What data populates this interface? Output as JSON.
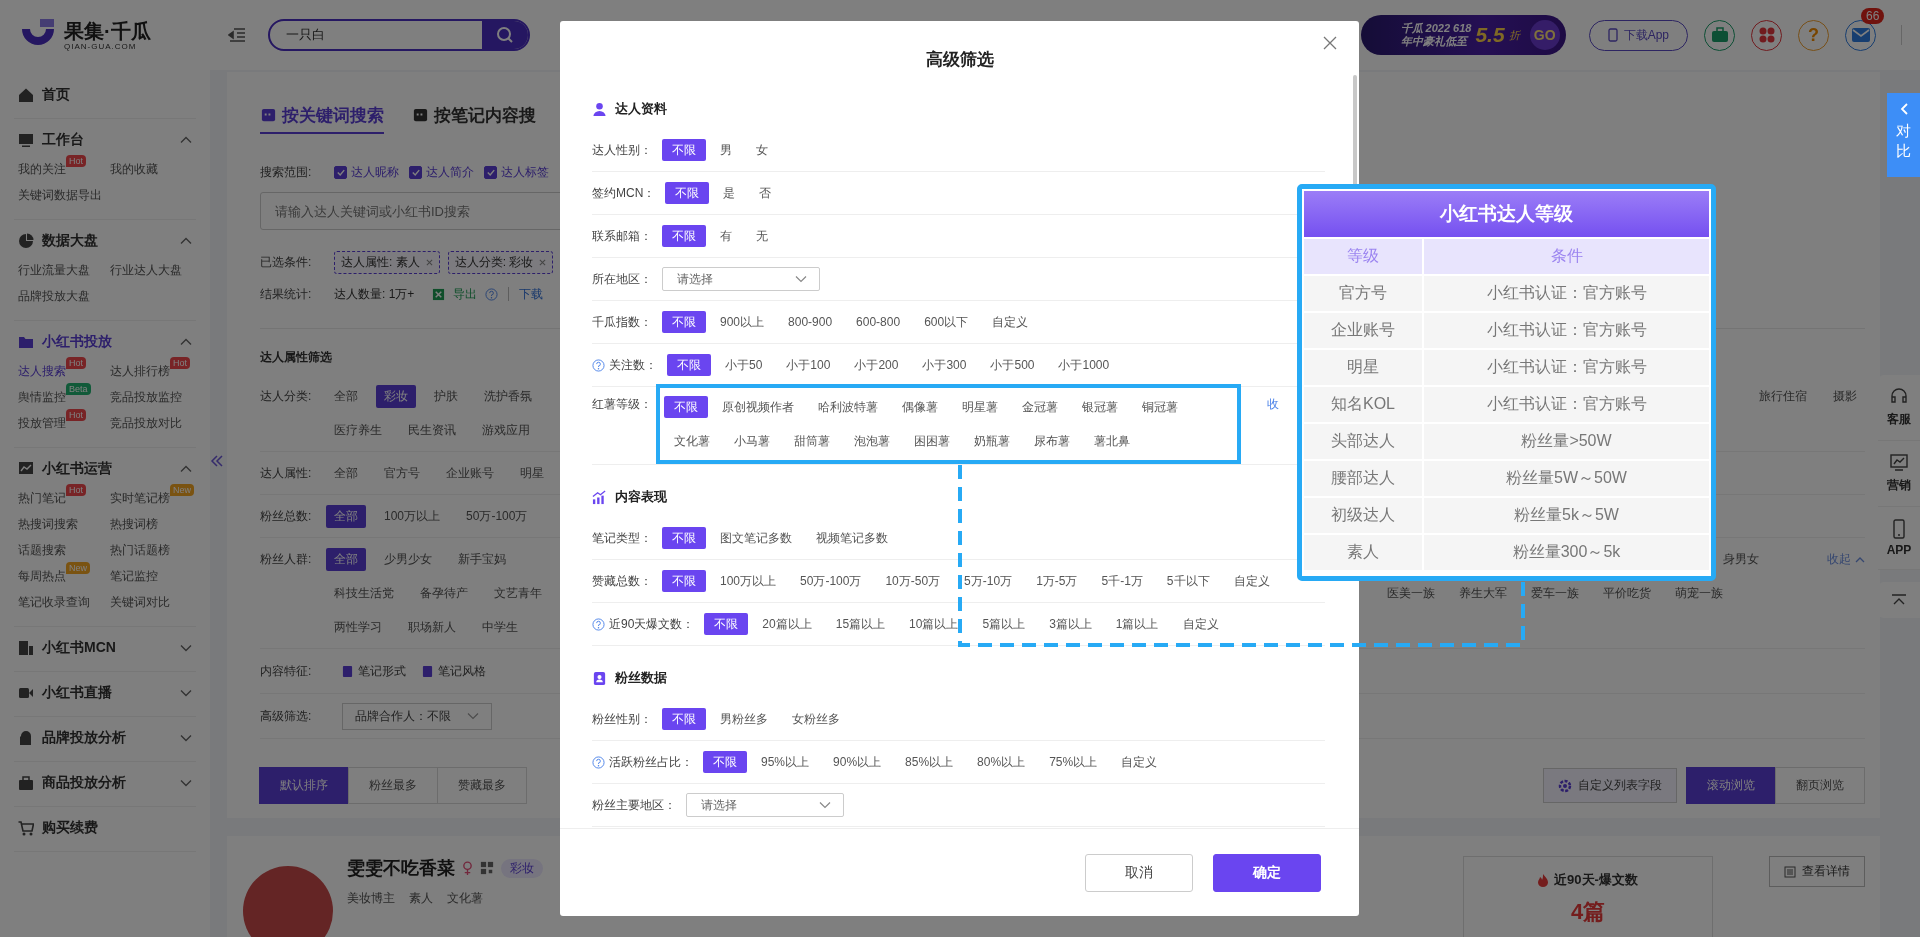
{
  "header": {
    "logo_name": "果集·千瓜",
    "logo_domain": "QIAN-GUA.COM",
    "search_value": "一只白",
    "promo": {
      "line1": "千瓜 2022 618",
      "line2": "年中豪礼低至",
      "discount": "5.5",
      "unit": "折",
      "go": "GO"
    },
    "download": "下载App",
    "help_glyph": "?",
    "mail_badge": "66"
  },
  "sidebar": [
    {
      "kind": "link",
      "label": "首页",
      "selected": false
    },
    {
      "kind": "group",
      "label": "工作台",
      "expanded": true,
      "selected": false,
      "children": [
        {
          "label": "我的关注",
          "badge": {
            "text": "Hot",
            "kind": "hot"
          },
          "selected": false
        },
        {
          "label": "我的收藏",
          "selected": false
        },
        {
          "label": "关键词数据导出",
          "selected": false
        }
      ]
    },
    {
      "kind": "group",
      "label": "数据大盘",
      "expanded": true,
      "selected": false,
      "children": [
        {
          "label": "行业流量大盘",
          "selected": false
        },
        {
          "label": "行业达人大盘",
          "selected": false
        },
        {
          "label": "品牌投放大盘",
          "selected": false
        }
      ]
    },
    {
      "kind": "group",
      "label": "小红书投放",
      "expanded": true,
      "selected": true,
      "children": [
        {
          "label": "达人搜索",
          "badge": {
            "text": "Hot",
            "kind": "hot"
          },
          "selected": true
        },
        {
          "label": "达人排行榜",
          "badge": {
            "text": "Hot",
            "kind": "hot"
          },
          "selected": false
        },
        {
          "label": "舆情监控",
          "badge": {
            "text": "Beta",
            "kind": "beta"
          },
          "selected": false
        },
        {
          "label": "竞品投放监控",
          "selected": false
        },
        {
          "label": "投放管理",
          "badge": {
            "text": "Hot",
            "kind": "hot"
          },
          "selected": false
        },
        {
          "label": "竞品投放对比",
          "selected": false
        }
      ]
    },
    {
      "kind": "group",
      "label": "小红书运营",
      "expanded": true,
      "selected": false,
      "children": [
        {
          "label": "热门笔记",
          "badge": {
            "text": "Hot",
            "kind": "hot"
          },
          "selected": false
        },
        {
          "label": "实时笔记榜",
          "badge": {
            "text": "New",
            "kind": "new"
          },
          "selected": false
        },
        {
          "label": "热搜词搜索",
          "selected": false
        },
        {
          "label": "热搜词榜",
          "selected": false
        },
        {
          "label": "话题搜索",
          "selected": false
        },
        {
          "label": "热门话题榜",
          "selected": false
        },
        {
          "label": "每周热点",
          "badge": {
            "text": "New",
            "kind": "new"
          },
          "selected": false
        },
        {
          "label": "笔记监控",
          "selected": false
        },
        {
          "label": "笔记收录查询",
          "selected": false
        },
        {
          "label": "关键词对比",
          "selected": false
        }
      ]
    },
    {
      "kind": "group",
      "label": "小红书MCN",
      "expanded": false,
      "selected": false
    },
    {
      "kind": "group",
      "label": "小红书直播",
      "expanded": false,
      "selected": false
    },
    {
      "kind": "group",
      "label": "品牌投放分析",
      "expanded": false,
      "selected": false
    },
    {
      "kind": "group",
      "label": "商品投放分析",
      "expanded": false,
      "selected": false
    },
    {
      "kind": "link",
      "label": "购买续费",
      "selected": false
    }
  ],
  "main": {
    "tabs": [
      {
        "label": "按关键词搜索",
        "selected": true
      },
      {
        "label": "按笔记内容搜",
        "selected": false
      }
    ],
    "scope": {
      "label": "搜索范围:",
      "options": [
        {
          "label": "达人昵称",
          "checked": true
        },
        {
          "label": "达人简介",
          "checked": true
        },
        {
          "label": "达人标签",
          "checked": true
        }
      ]
    },
    "search_placeholder": "请输入达人关键词或小红书ID搜索",
    "conditions": {
      "label": "已选条件:",
      "tags": [
        "达人属性: 素人",
        "达人分类: 彩妆"
      ]
    },
    "result": {
      "label": "结果统计:",
      "count": "达人数量: 1万+",
      "export": "导出",
      "download": "下载"
    },
    "filter_title": "达人属性筛选",
    "filters": [
      {
        "label": "达人分类:",
        "lines": [
          {
            "left": [
              {
                "label": "全部",
                "selected": false
              },
              {
                "label": "彩妆",
                "selected": true
              },
              {
                "label": "护肤",
                "selected": false
              },
              {
                "label": "洗护香氛",
                "selected": false
              }
            ],
            "right": [
              {
                "label": "旅行住宿",
                "selected": false
              },
              {
                "label": "摄影",
                "selected": false
              }
            ]
          },
          {
            "left": [
              {
                "label": "医疗养生",
                "selected": false
              },
              {
                "label": "民生资讯",
                "selected": false
              },
              {
                "label": "游戏应用",
                "selected": false
              }
            ]
          }
        ]
      },
      {
        "label": "达人属性:",
        "lines": [
          {
            "left": [
              {
                "label": "全部",
                "selected": false
              },
              {
                "label": "官方号",
                "selected": false
              },
              {
                "label": "企业账号",
                "selected": false
              },
              {
                "label": "明星",
                "selected": false
              }
            ]
          }
        ]
      },
      {
        "label": "粉丝总数:",
        "lines": [
          {
            "left": [
              {
                "label": "全部",
                "selected": true
              },
              {
                "label": "100万以上",
                "selected": false
              },
              {
                "label": "50万-100万",
                "selected": false
              }
            ]
          }
        ]
      },
      {
        "label": "粉丝人群:",
        "collapse": "收起",
        "lines": [
          {
            "left": [
              {
                "label": "全部",
                "selected": true
              },
              {
                "label": "少男少女",
                "selected": false
              },
              {
                "label": "新手宝妈",
                "selected": false
              }
            ],
            "right": [
              {
                "label": "身男女",
                "selected": false
              }
            ]
          },
          {
            "left": [
              {
                "label": "科技生活党",
                "selected": false
              },
              {
                "label": "备孕待产",
                "selected": false
              },
              {
                "label": "文艺青年",
                "selected": false
              }
            ],
            "right": [
              {
                "label": "医美一族",
                "selected": false
              },
              {
                "label": "养生大军",
                "selected": false
              },
              {
                "label": "爱车一族",
                "selected": false
              },
              {
                "label": "平价吃货",
                "selected": false
              },
              {
                "label": "萌宠一族",
                "selected": false
              }
            ]
          },
          {
            "left": [
              {
                "label": "两性学习",
                "selected": false
              },
              {
                "label": "职场新人",
                "selected": false
              },
              {
                "label": "中学生",
                "selected": false
              }
            ]
          }
        ]
      }
    ],
    "features": {
      "label": "内容特征:",
      "items": [
        "笔记形式",
        "笔记风格"
      ]
    },
    "advanced": {
      "label": "高级筛选:",
      "dropdowns": [
        "品牌合作人：不限"
      ]
    },
    "sort": [
      {
        "label": "默认排序",
        "selected": true
      },
      {
        "label": "粉丝最多",
        "selected": false
      },
      {
        "label": "赞藏最多",
        "selected": false
      }
    ],
    "custom_fields": "自定义列表字段",
    "view_modes": [
      {
        "label": "滚动浏览",
        "selected": true
      },
      {
        "label": "翻页浏览",
        "selected": false
      }
    ],
    "card": {
      "name": "雯雯不吃香菜",
      "category": "彩妆",
      "tags": [
        "美妆博主",
        "素人",
        "文化薯"
      ],
      "stat_title": "近90天-爆文数",
      "stat_value": "4篇",
      "detail": "查看详情"
    }
  },
  "compare_tab": "对比",
  "side_tools": [
    "客服",
    "营销",
    "APP"
  ],
  "modal": {
    "title": "高级筛选",
    "sections": [
      {
        "title": "达人资料",
        "rows": [
          {
            "kind": "options",
            "label": "达人性别：",
            "help": false,
            "options": [
              {
                "label": "不限",
                "selected": true
              },
              {
                "label": "男",
                "selected": false
              },
              {
                "label": "女",
                "selected": false
              }
            ]
          },
          {
            "kind": "options",
            "label": "签约MCN：",
            "help": false,
            "options": [
              {
                "label": "不限",
                "selected": true
              },
              {
                "label": "是",
                "selected": false
              },
              {
                "label": "否",
                "selected": false
              }
            ]
          },
          {
            "kind": "options",
            "label": "联系邮箱：",
            "help": false,
            "options": [
              {
                "label": "不限",
                "selected": true
              },
              {
                "label": "有",
                "selected": false
              },
              {
                "label": "无",
                "selected": false
              }
            ]
          },
          {
            "kind": "select",
            "label": "所在地区：",
            "placeholder": "请选择"
          },
          {
            "kind": "options",
            "label": "千瓜指数：",
            "help": false,
            "options": [
              {
                "label": "不限",
                "selected": true
              },
              {
                "label": "900以上",
                "selected": false
              },
              {
                "label": "800-900",
                "selected": false
              },
              {
                "label": "600-800",
                "selected": false
              },
              {
                "label": "600以下",
                "selected": false
              },
              {
                "label": "自定义",
                "selected": false
              }
            ]
          },
          {
            "kind": "options",
            "label": "关注数：",
            "help": true,
            "options": [
              {
                "label": "不限",
                "selected": true
              },
              {
                "label": "小于50",
                "selected": false
              },
              {
                "label": "小于100",
                "selected": false
              },
              {
                "label": "小于200",
                "selected": false
              },
              {
                "label": "小于300",
                "selected": false
              },
              {
                "label": "小于500",
                "selected": false
              },
              {
                "label": "小于1000",
                "selected": false
              }
            ]
          },
          {
            "kind": "options",
            "label": "红薯等级：",
            "help": false,
            "highlighted": true,
            "collapse": "收",
            "options": [
              {
                "label": "不限",
                "selected": true
              },
              {
                "label": "原创视频作者",
                "selected": false
              },
              {
                "label": "哈利波特薯",
                "selected": false
              },
              {
                "label": "偶像薯",
                "selected": false
              },
              {
                "label": "明星薯",
                "selected": false
              },
              {
                "label": "金冠薯",
                "selected": false
              },
              {
                "label": "银冠薯",
                "selected": false
              },
              {
                "label": "铜冠薯",
                "selected": false
              },
              {
                "label": "文化薯",
                "selected": false
              },
              {
                "label": "小马薯",
                "selected": false
              },
              {
                "label": "甜筒薯",
                "selected": false
              },
              {
                "label": "泡泡薯",
                "selected": false
              },
              {
                "label": "困困薯",
                "selected": false
              },
              {
                "label": "奶瓶薯",
                "selected": false
              },
              {
                "label": "尿布薯",
                "selected": false
              },
              {
                "label": "薯北鼻",
                "selected": false
              }
            ]
          }
        ]
      },
      {
        "title": "内容表现",
        "rows": [
          {
            "kind": "options",
            "label": "笔记类型：",
            "help": false,
            "options": [
              {
                "label": "不限",
                "selected": true
              },
              {
                "label": "图文笔记多数",
                "selected": false
              },
              {
                "label": "视频笔记多数",
                "selected": false
              }
            ]
          },
          {
            "kind": "options",
            "label": "赞藏总数：",
            "help": false,
            "options": [
              {
                "label": "不限",
                "selected": true
              },
              {
                "label": "100万以上",
                "selected": false
              },
              {
                "label": "50万-100万",
                "selected": false
              },
              {
                "label": "10万-50万",
                "selected": false
              },
              {
                "label": "5万-10万",
                "selected": false
              },
              {
                "label": "1万-5万",
                "selected": false
              },
              {
                "label": "5千-1万",
                "selected": false
              },
              {
                "label": "5千以下",
                "selected": false
              },
              {
                "label": "自定义",
                "selected": false
              }
            ]
          },
          {
            "kind": "options",
            "label": "近90天爆文数：",
            "help": true,
            "options": [
              {
                "label": "不限",
                "selected": true
              },
              {
                "label": "20篇以上",
                "selected": false
              },
              {
                "label": "15篇以上",
                "selected": false
              },
              {
                "label": "10篇以上",
                "selected": false
              },
              {
                "label": "5篇以上",
                "selected": false
              },
              {
                "label": "3篇以上",
                "selected": false
              },
              {
                "label": "1篇以上",
                "selected": false
              },
              {
                "label": "自定义",
                "selected": false
              }
            ]
          }
        ]
      },
      {
        "title": "粉丝数据",
        "rows": [
          {
            "kind": "options",
            "label": "粉丝性别：",
            "help": false,
            "options": [
              {
                "label": "不限",
                "selected": true
              },
              {
                "label": "男粉丝多",
                "selected": false
              },
              {
                "label": "女粉丝多",
                "selected": false
              }
            ]
          },
          {
            "kind": "options",
            "label": "活跃粉丝占比：",
            "help": true,
            "options": [
              {
                "label": "不限",
                "selected": true
              },
              {
                "label": "95%以上",
                "selected": false
              },
              {
                "label": "90%以上",
                "selected": false
              },
              {
                "label": "85%以上",
                "selected": false
              },
              {
                "label": "80%以上",
                "selected": false
              },
              {
                "label": "75%以上",
                "selected": false
              },
              {
                "label": "自定义",
                "selected": false
              }
            ]
          },
          {
            "kind": "select",
            "label": "粉丝主要地区：",
            "placeholder": "请选择"
          }
        ]
      }
    ],
    "cancel": "取消",
    "confirm": "确定"
  },
  "level_table": {
    "title": "小红书达人等级",
    "columns": [
      "等级",
      "条件"
    ],
    "rows": [
      [
        "官方号",
        "小红书认证：官方账号"
      ],
      [
        "企业账号",
        "小红书认证：官方账号"
      ],
      [
        "明星",
        "小红书认证：官方账号"
      ],
      [
        "知名KOL",
        "小红书认证：官方账号"
      ],
      [
        "头部达人",
        "粉丝量>50W"
      ],
      [
        "腰部达人",
        "粉丝量5W～50W"
      ],
      [
        "初级达人",
        "粉丝量5k～5W"
      ],
      [
        "素人",
        "粉丝量300～5k"
      ]
    ]
  }
}
